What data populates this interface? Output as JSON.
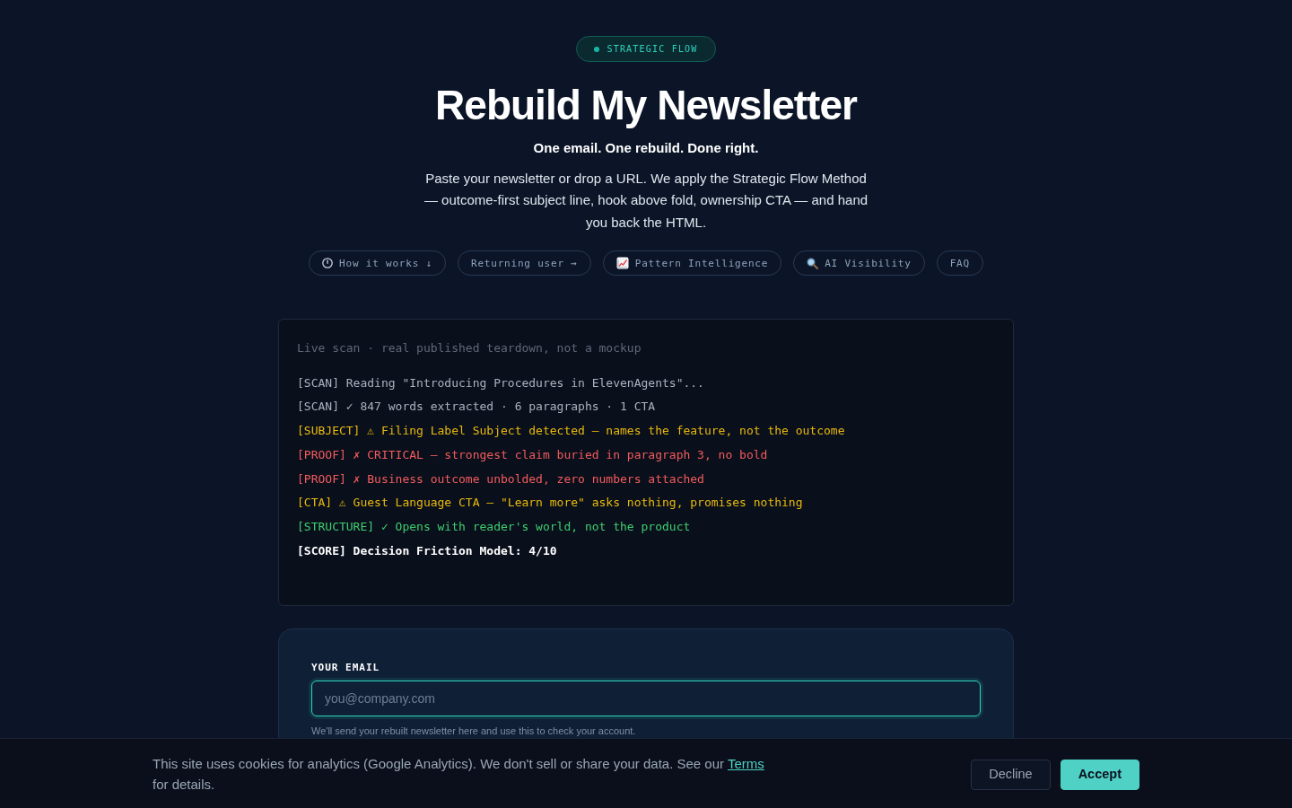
{
  "badge": {
    "label": "STRATEGIC FLOW"
  },
  "title": "Rebuild My Newsletter",
  "tagline": "One email. One rebuild. Done right.",
  "intro": "Paste your newsletter or drop a URL. We apply the Strategic Flow Method — outcome-first subject line, hook above fold, ownership CTA — and hand you back the HTML.",
  "nav_pills": [
    {
      "label": "How it works ↓"
    },
    {
      "label": "Returning user →"
    },
    {
      "label": "Pattern Intelligence"
    },
    {
      "label": "AI Visibility"
    },
    {
      "label": "FAQ"
    }
  ],
  "terminal": {
    "caption": "Live scan · real published teardown, not a mockup",
    "lines": [
      {
        "kind": "scan",
        "text": "[SCAN] Reading \"Introducing Procedures in ElevenAgents\"..."
      },
      {
        "kind": "scan",
        "text": "[SCAN] ✓ 847 words extracted · 6 paragraphs · 1 CTA"
      },
      {
        "kind": "warn",
        "text": "[SUBJECT] ⚠ Filing Label Subject detected — names the feature, not the outcome"
      },
      {
        "kind": "error",
        "text": "[PROOF] ✗ CRITICAL — strongest claim buried in paragraph 3, no bold"
      },
      {
        "kind": "error",
        "text": "[PROOF] ✗ Business outcome unbolded, zero numbers attached"
      },
      {
        "kind": "warn",
        "text": "[CTA] ⚠ Guest Language CTA — \"Learn more\" asks nothing, promises nothing"
      },
      {
        "kind": "ok",
        "text": "[STRUCTURE] ✓ Opens with reader's world, not the product"
      },
      {
        "kind": "score",
        "text": "[SCORE] Decision Friction Model: 4/10"
      }
    ]
  },
  "email_form": {
    "label": "YOUR EMAIL",
    "placeholder": "you@company.com",
    "hint": "We'll send your rebuilt newsletter here and use this to check your account."
  },
  "cookie_banner": {
    "text": "This site uses cookies for analytics (Google Analytics). We don't sell or share your data. See our",
    "link": "Terms",
    "text_after": "for details.",
    "buttons": [
      {
        "label": "Decline",
        "kind": "secondary"
      },
      {
        "label": "Accept",
        "kind": "primary"
      }
    ]
  }
}
